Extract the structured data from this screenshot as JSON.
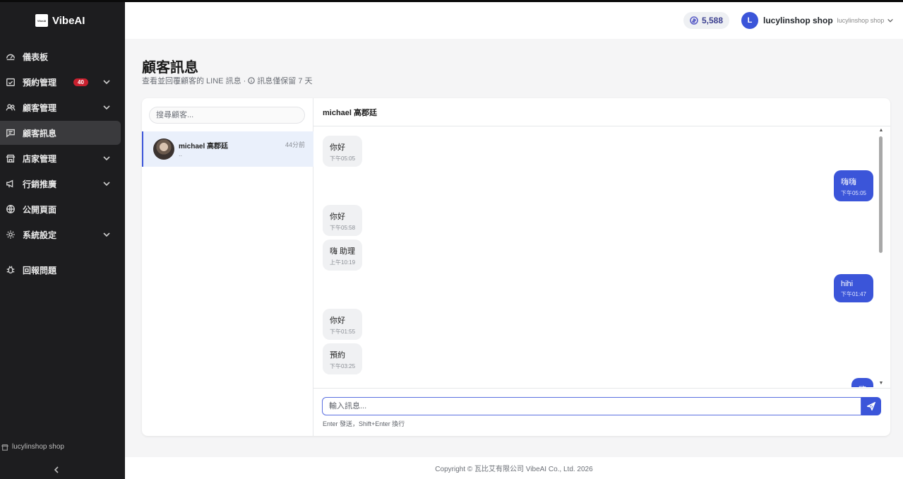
{
  "brand": {
    "name": "VibeAI",
    "logo_text": "VibeAI"
  },
  "sidebar": {
    "items": [
      {
        "label": "儀表板",
        "icon": "dashboard-icon"
      },
      {
        "label": "預約管理",
        "icon": "calendar-check-icon",
        "badge": "40",
        "expandable": true
      },
      {
        "label": "顧客管理",
        "icon": "users-icon",
        "expandable": true
      },
      {
        "label": "顧客訊息",
        "icon": "message-icon",
        "active": true
      },
      {
        "label": "店家管理",
        "icon": "store-icon",
        "expandable": true
      },
      {
        "label": "行銷推廣",
        "icon": "megaphone-icon",
        "expandable": true
      },
      {
        "label": "公開頁面",
        "icon": "globe-icon"
      },
      {
        "label": "系統設定",
        "icon": "gear-icon",
        "expandable": true
      },
      {
        "label": "回報問題",
        "icon": "bug-icon"
      }
    ],
    "footer_shop": "lucylinshop shop"
  },
  "topbar": {
    "credits": "5,588",
    "user_initial": "L",
    "user_name": "lucylinshop shop",
    "user_shop": "lucylinshop shop"
  },
  "page": {
    "title": "顧客訊息",
    "subtitle_main": "查看並回覆顧客的 LINE 訊息 ·",
    "subtitle_note": "訊息僅保留 7 天"
  },
  "conversation_list": {
    "search_placeholder": "搜尋顧客...",
    "items": [
      {
        "name": "michael 高郡廷",
        "time": "44分前",
        "preview": ".."
      }
    ]
  },
  "chat": {
    "header": "michael 高郡廷",
    "messages": [
      {
        "dir": "in",
        "text": "你好",
        "time": "下午05:05"
      },
      {
        "dir": "out",
        "text": "嗨嗨",
        "time": "下午05:05"
      },
      {
        "dir": "in",
        "text": "你好",
        "time": "下午05:58"
      },
      {
        "dir": "in",
        "text": "嗨 助理",
        "time": "上午10:19"
      },
      {
        "dir": "out",
        "text": "hihi",
        "time": "下午01:47"
      },
      {
        "dir": "in",
        "text": "你好",
        "time": "下午01:55"
      },
      {
        "dir": "in",
        "text": "預約",
        "time": "下午03:25"
      },
      {
        "dir": "out",
        "text": "嗨",
        "time": ""
      }
    ],
    "input_placeholder": "輸入訊息...",
    "hint": "Enter 發送，Shift+Enter 換行"
  },
  "footer": "Copyright © 瓦比艾有限公司 VibeAI Co., Ltd. 2026",
  "colors": {
    "accent": "#3b55d9",
    "sidebar_bg": "#1d1d1f",
    "badge": "#c8202e"
  }
}
